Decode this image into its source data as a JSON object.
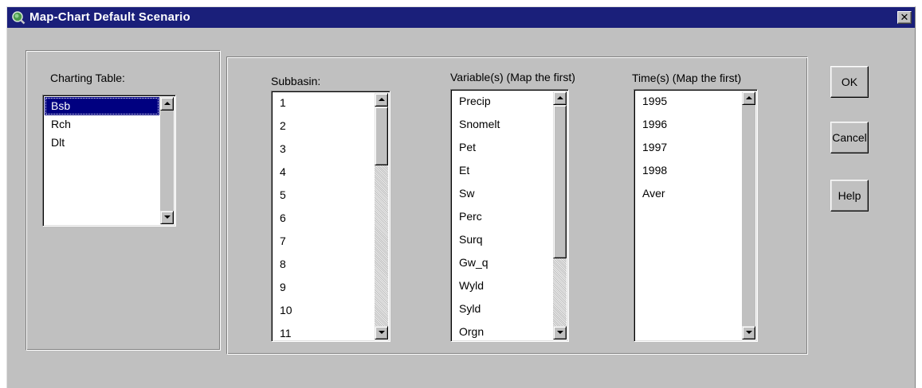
{
  "window": {
    "title": "Map-Chart Default Scenario",
    "close_glyph": "✕"
  },
  "charting_table": {
    "label": "Charting Table:",
    "items": [
      "Bsb",
      "Rch",
      "Dlt"
    ],
    "selected": "Bsb"
  },
  "subbasin": {
    "label": "Subbasin:",
    "items": [
      "1",
      "2",
      "3",
      "4",
      "5",
      "6",
      "7",
      "8",
      "9",
      "10",
      "11"
    ]
  },
  "variables": {
    "label": "Variable(s) (Map the first)",
    "items": [
      "Precip",
      "Snomelt",
      "Pet",
      "Et",
      "Sw",
      "Perc",
      "Surq",
      "Gw_q",
      "Wyld",
      "Syld",
      "Orgn"
    ]
  },
  "times": {
    "label": "Time(s)  (Map the first)",
    "items": [
      "1995",
      "1996",
      "1997",
      "1998",
      "Aver"
    ]
  },
  "buttons": {
    "ok": "OK",
    "cancel": "Cancel",
    "help": "Help"
  },
  "icons": {
    "app": "globe-magnifier-icon",
    "close": "close-icon",
    "scroll_up": "arrow-up-icon",
    "scroll_down": "arrow-down-icon"
  }
}
